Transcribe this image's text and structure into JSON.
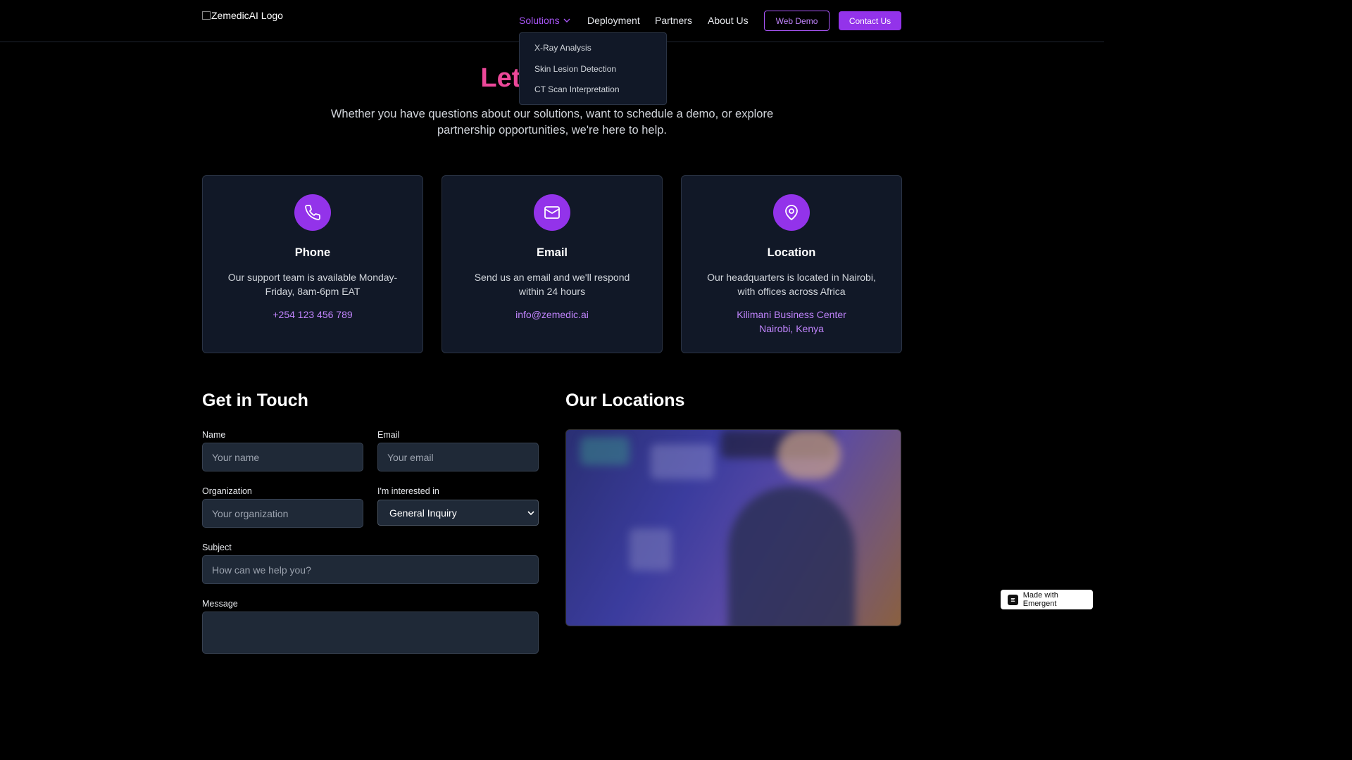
{
  "header": {
    "logo_alt": "ZemedicAI Logo",
    "nav": {
      "solutions": "Solutions",
      "deployment": "Deployment",
      "partners": "Partners",
      "about": "About Us"
    },
    "web_demo": "Web Demo",
    "contact": "Contact Us"
  },
  "dropdown": {
    "items": [
      "X-Ray Analysis",
      "Skin Lesion Detection",
      "CT Scan Interpretation"
    ]
  },
  "hero": {
    "title": "Let's",
    "subtitle": "Whether you have questions about our solutions, want to schedule a demo, or explore partnership opportunities, we're here to help."
  },
  "cards": [
    {
      "icon": "phone-icon",
      "title": "Phone",
      "desc": "Our support team is available Monday-Friday, 8am-6pm EAT",
      "link": "+254 123 456 789"
    },
    {
      "icon": "mail-icon",
      "title": "Email",
      "desc": "Send us an email and we'll respond within 24 hours",
      "link": "info@zemedic.ai"
    },
    {
      "icon": "location-icon",
      "title": "Location",
      "desc": "Our headquarters is located in Nairobi, with offices across Africa",
      "link": "Kilimani Business Center",
      "link2": "Nairobi, Kenya"
    }
  ],
  "form": {
    "title": "Get in Touch",
    "name_label": "Name",
    "name_placeholder": "Your name",
    "email_label": "Email",
    "email_placeholder": "Your email",
    "org_label": "Organization",
    "org_placeholder": "Your organization",
    "interest_label": "I'm interested in",
    "interest_value": "General Inquiry",
    "subject_label": "Subject",
    "subject_placeholder": "How can we help you?",
    "message_label": "Message"
  },
  "locations": {
    "title": "Our Locations"
  },
  "badge": {
    "label": "Made with Emergent"
  },
  "colors": {
    "accent": "#9333ea",
    "accent_light": "#c084fc",
    "hero_title": "#ec4899",
    "card_bg": "#111827"
  }
}
